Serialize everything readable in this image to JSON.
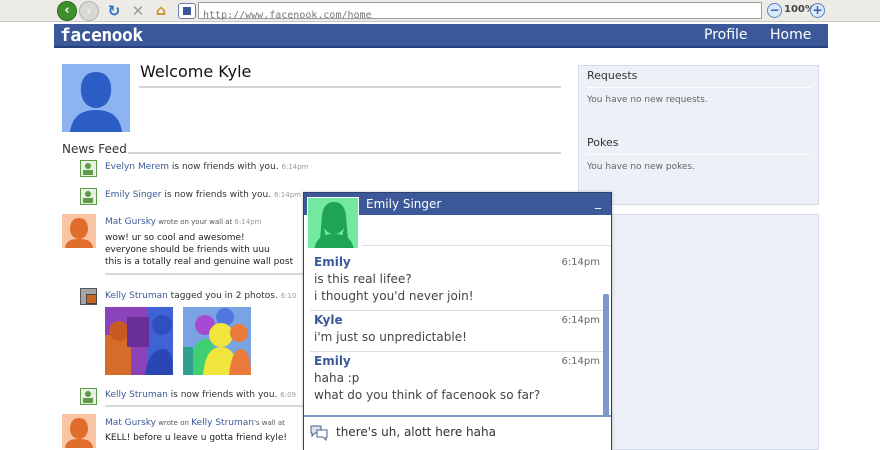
{
  "browser": {
    "url": "http://www.facenook.com/home",
    "zoom": "100%",
    "icons": [
      "back-icon",
      "forward-icon",
      "reload-icon",
      "stop-icon",
      "home-icon",
      "site-icon",
      "zoom-out-icon",
      "zoom-in-icon"
    ]
  },
  "header": {
    "logo": "facenook",
    "nav": {
      "profile": "Profile",
      "home": "Home"
    },
    "color": "#3b5998"
  },
  "welcome": "Welcome Kyle",
  "news_feed": {
    "title": "News Feed",
    "items": [
      {
        "name": "Evelyn Merem",
        "text": " is now friends with you.",
        "time": "6:14pm"
      },
      {
        "name": "Emily Singer",
        "text": " is now friends with you.",
        "time": "6:14pm"
      },
      {
        "name": "Mat Gursky",
        "action": " wrote on your wall at ",
        "time": "6:14pm",
        "lines": [
          "wow! ur so cool and awesome!",
          "everyone should be friends with uuu",
          "this is a totally real and genuine wall post"
        ]
      },
      {
        "name": "Kelly Struman",
        "text": " tagged you in 2 photos.",
        "time": "6:10"
      },
      {
        "name": "Kelly Struman",
        "text": " is now friends with you.",
        "time": "6:09"
      },
      {
        "name": "Mat Gursky",
        "action": " wrote on ",
        "target": "Kelly Struman",
        "action2": "'s wall at",
        "lines": [
          "KELL! before u leave u gotta friend kyle!"
        ]
      }
    ]
  },
  "sidebar": {
    "requests": {
      "title": "Requests",
      "text": "You have no new requests."
    },
    "pokes": {
      "title": "Pokes",
      "text": "You have no new pokes."
    }
  },
  "chat": {
    "title": "Emily Singer",
    "minimize": "_",
    "messages": [
      {
        "sender": "Emily",
        "time": "6:14pm",
        "lines": [
          "is this real lifee?",
          "i thought you'd never join!"
        ]
      },
      {
        "sender": "Kyle",
        "time": "6:14pm",
        "lines": [
          "i'm just so unpredictable!"
        ]
      },
      {
        "sender": "Emily",
        "time": "6:14pm",
        "lines": [
          "haha :p",
          "what do you think of facenook so far?"
        ]
      }
    ],
    "input_value": "there's uh, alott here haha"
  }
}
